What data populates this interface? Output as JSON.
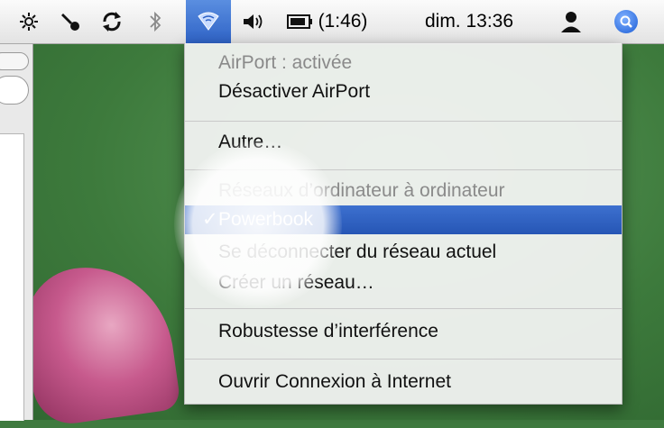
{
  "menubar": {
    "battery_time": "(1:46)",
    "clock": "dim. 13:36"
  },
  "menu": {
    "airport_status": "AirPort : activée",
    "disable_airport": "Désactiver AirPort",
    "other": "Autre…",
    "adhoc_header": "Réseaux d’ordinateur à ordinateur",
    "selected_network": "Powerbook",
    "check_mark": "✓",
    "disconnect": "Se déconnecter du réseau actuel",
    "create_network": "Créer un réseau…",
    "interference": "Robustesse d’interférence",
    "open_internet_connect": "Ouvrir Connexion à Internet"
  },
  "icons": [
    "sun-icon",
    "wrench-icon",
    "sync-icon",
    "bluetooth-icon",
    "airport-icon",
    "volume-icon",
    "battery-icon",
    "user-icon",
    "spotlight-icon"
  ],
  "colors": {
    "selection": "#2f63c6",
    "desktop_green": "#3d7a3c"
  }
}
